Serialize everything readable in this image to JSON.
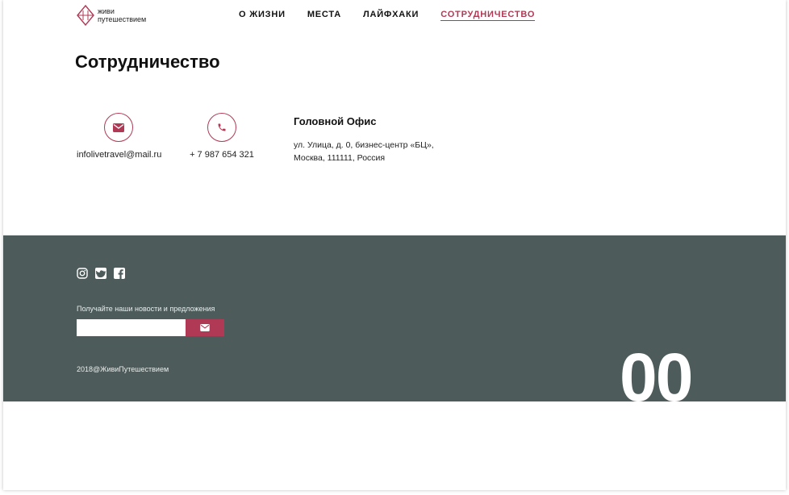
{
  "header": {
    "logo_line1": "живи",
    "logo_line2": "путешествием",
    "nav": [
      {
        "label": "О ЖИЗНИ"
      },
      {
        "label": "МЕСТА"
      },
      {
        "label": "ЛАЙФХАКИ"
      },
      {
        "label": "СОТРУДНИЧЕСТВО",
        "active": true
      }
    ]
  },
  "main": {
    "title": "Сотрудничество",
    "email": {
      "icon": "envelope-icon",
      "text": "infolivetravel@mail.ru"
    },
    "phone": {
      "icon": "phone-icon",
      "text": "+ 7 987 654 321"
    },
    "office": {
      "title": "Головной Офис",
      "address_line1": "ул. Улица, д. 0, бизнес-центр «БЦ»,",
      "address_line2": "Москва, 111111, Россия"
    }
  },
  "footer": {
    "socials": [
      "instagram-icon",
      "twitter-icon",
      "facebook-icon"
    ],
    "subscribe_label": "Получайте наши новости и предложения",
    "subscribe_placeholder": "",
    "copyright": "2018@ЖивиПутешествием",
    "big_number": "00"
  },
  "colors": {
    "accent": "#b03a55",
    "footer_bg": "#4d5c5b"
  }
}
